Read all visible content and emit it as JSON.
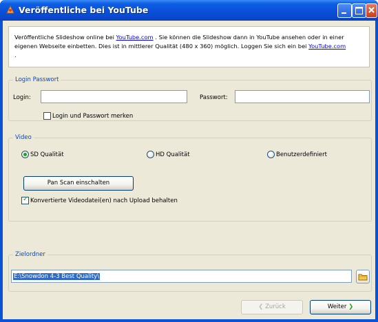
{
  "window": {
    "title": "Veröffentliche bei YouTube"
  },
  "intro": {
    "part1": "Veröffentliche Slideshow online bei ",
    "link1": "YouTube.com",
    "part2": " . Sie können die Slideshow dann in YouTube ansehen oder in einer eigenen Webseite einbetten. Dies ist in mittlerer Qualität (480 x 360) möglich. Loggen Sie sich ein bei ",
    "link2": "YouTube.com",
    "part3": " ."
  },
  "login_group": {
    "title": "Login  Passwort",
    "login_label": "Login:",
    "login_value": "",
    "password_label": "Passwort:",
    "password_value": "",
    "remember_label": "Login und Passwort merken",
    "remember_checked": false
  },
  "video_group": {
    "title": "Video",
    "radios": [
      {
        "label": "SD Qualität",
        "selected": true
      },
      {
        "label": "HD Qualität",
        "selected": false
      },
      {
        "label": "Benutzerdefiniert",
        "selected": false
      }
    ],
    "panscan_button": "Pan  Scan einschalten",
    "keep_label": "Konvertierte Videodatei(en) nach Upload behalten",
    "keep_checked": true
  },
  "target_group": {
    "title": "Zielordner",
    "path": "E:\\Snowdon 4-3 Best Quality\\"
  },
  "footer": {
    "back_label": "Zurück",
    "next_label": "Weiter"
  },
  "colors": {
    "group_title": "#0046d5",
    "titlebar": "#0a52d6",
    "check_green": "#21a121",
    "selection": "#316ac5"
  }
}
